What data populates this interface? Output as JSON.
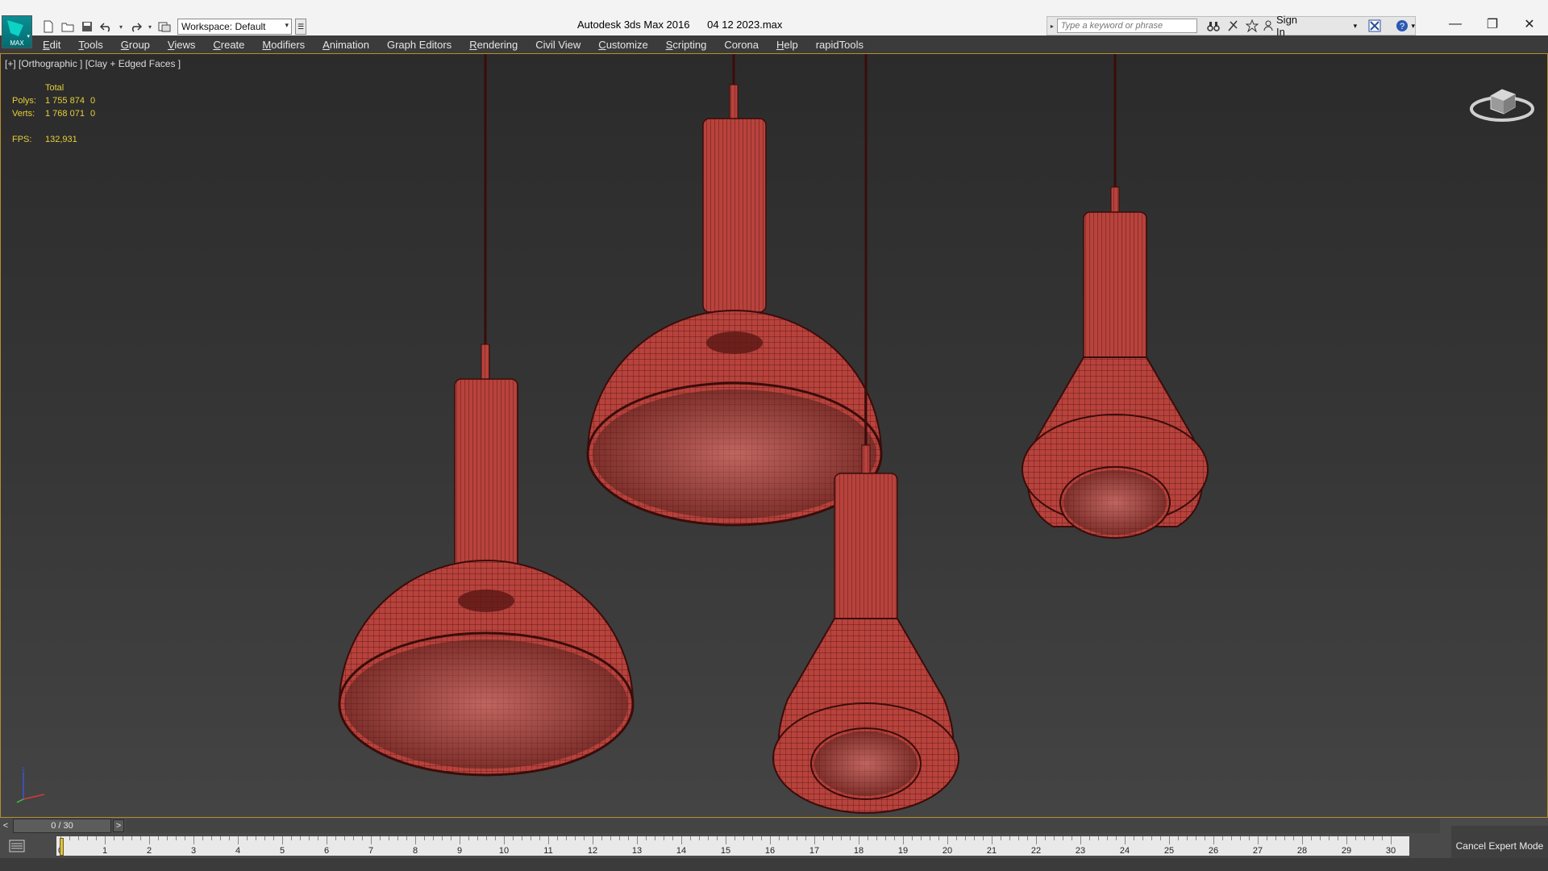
{
  "app": {
    "logo_label": "MAX",
    "title": "Autodesk 3ds Max 2016      04 12 2023.max",
    "workspace": "Workspace: Default"
  },
  "search": {
    "placeholder": "Type a keyword or phrase",
    "sign_in": "Sign In"
  },
  "menu": [
    "Edit",
    "Tools",
    "Group",
    "Views",
    "Create",
    "Modifiers",
    "Animation",
    "Graph Editors",
    "Rendering",
    "Civil View",
    "Customize",
    "Scripting",
    "Corona",
    "Help",
    "rapidTools"
  ],
  "viewport": {
    "label": "[+] [Orthographic ] [Clay + Edged Faces ]",
    "stats": {
      "total_label": "Total",
      "polys_label": "Polys:",
      "polys_value": "1 755 874",
      "polys_sel": "0",
      "verts_label": "Verts:",
      "verts_value": "1 768 071",
      "verts_sel": "0",
      "fps_label": "FPS:",
      "fps_value": "132,931"
    },
    "mesh_color": "#b8423c",
    "wire_color": "#4a1210"
  },
  "timeline": {
    "frame_display": "0 / 30",
    "prev": "<",
    "next": ">",
    "ticks": [
      "0",
      "1",
      "2",
      "3",
      "4",
      "5",
      "6",
      "7",
      "8",
      "9",
      "10",
      "11",
      "12",
      "13",
      "14",
      "15",
      "16",
      "17",
      "18",
      "19",
      "20",
      "21",
      "22",
      "23",
      "24",
      "25",
      "26",
      "27",
      "28",
      "29",
      "30"
    ]
  },
  "status": {
    "cancel_expert": "Cancel Expert Mode"
  },
  "colors": {
    "accent": "#e7cf3a",
    "viewport_border": "#b58e2c",
    "menubar": "#3b3b3b"
  }
}
